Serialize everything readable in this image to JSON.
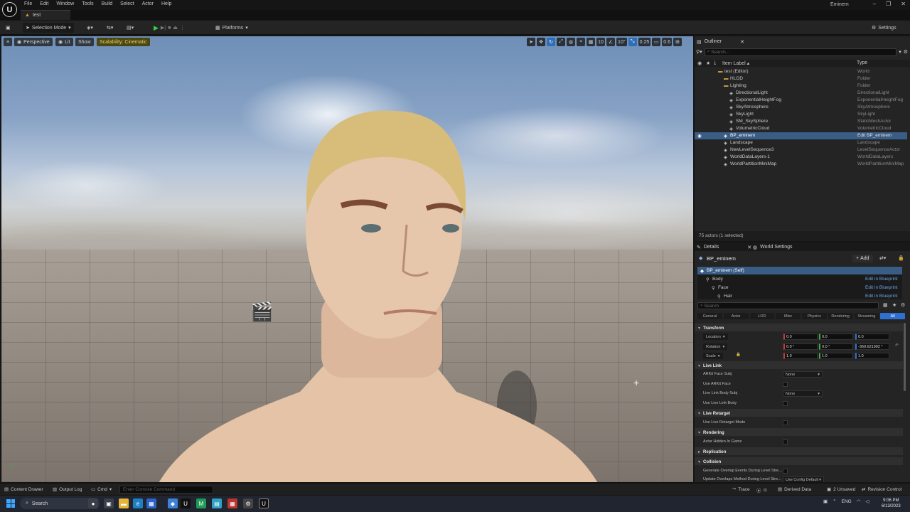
{
  "menubar": {
    "logo": "U",
    "items": [
      "File",
      "Edit",
      "Window",
      "Tools",
      "Build",
      "Select",
      "Actor",
      "Help"
    ],
    "user": "Eminem",
    "window_controls": [
      "–",
      "❐",
      "✕"
    ]
  },
  "document_tab": {
    "label": "test"
  },
  "toolbar": {
    "save_icon": "save-icon",
    "mode_label": "Selection Mode",
    "platforms_label": "Platforms",
    "settings_label": "Settings"
  },
  "viewport": {
    "perspective_label": "Perspective",
    "lit_label": "Lit",
    "show_label": "Show",
    "scalability_label": "Scalability: Cinematic",
    "grid_size": "10",
    "angle_snap": "10°",
    "scale_snap": "0.25",
    "camera_speed": "0.6"
  },
  "outliner": {
    "tab_label": "Outliner",
    "search_placeholder": "Search...",
    "col_label": "Item Label ▴",
    "col_type": "Type",
    "rows": [
      {
        "label": "test (Editor)",
        "type": "World",
        "indent": 0
      },
      {
        "label": "HLOD",
        "type": "Folder",
        "indent": 1
      },
      {
        "label": "Lighting",
        "type": "Folder",
        "indent": 1
      },
      {
        "label": "DirectionalLight",
        "type": "DirectionalLight",
        "indent": 2
      },
      {
        "label": "ExponentialHeightFog",
        "type": "ExponentialHeightFog",
        "indent": 2
      },
      {
        "label": "SkyAtmosphere",
        "type": "SkyAtmosphere",
        "indent": 2
      },
      {
        "label": "SkyLight",
        "type": "SkyLight",
        "indent": 2
      },
      {
        "label": "SM_SkySphere",
        "type": "StaticMeshActor",
        "indent": 2
      },
      {
        "label": "VolumetricCloud",
        "type": "VolumetricCloud",
        "indent": 2
      },
      {
        "label": "BP_eminem",
        "type": "Edit BP_eminem",
        "indent": 1,
        "selected": true
      },
      {
        "label": "Landscape",
        "type": "Landscape",
        "indent": 1
      },
      {
        "label": "NewLevelSequence3",
        "type": "LevelSequenceActor",
        "indent": 1
      },
      {
        "label": "WorldDataLayers-1",
        "type": "WorldDataLayers",
        "indent": 1
      },
      {
        "label": "WorldPartitionMiniMap",
        "type": "WorldPartitionMiniMap",
        "indent": 1
      }
    ],
    "status": "75 actors (1 selected)"
  },
  "details": {
    "tab_label": "Details",
    "tab2_label": "World Settings",
    "actor_name": "BP_eminem",
    "add_label": "Add",
    "components": [
      {
        "label": "BP_eminem (Self)",
        "link": "",
        "indent": 0,
        "selected": true
      },
      {
        "label": "Body",
        "link": "Edit in Blueprint",
        "indent": 1
      },
      {
        "label": "Face",
        "link": "Edit in Blueprint",
        "indent": 2
      },
      {
        "label": "Hair",
        "link": "Edit in Blueprint",
        "indent": 3
      }
    ],
    "search_placeholder": "Search",
    "categories": [
      "General",
      "Actor",
      "LOD",
      "Misc",
      "Physics",
      "Rendering",
      "Streaming",
      "All"
    ],
    "transform": {
      "title": "Transform",
      "location_label": "Location",
      "rotation_label": "Rotation",
      "scale_label": "Scale",
      "location": [
        "0.0",
        "0.0",
        "0.0"
      ],
      "rotation": [
        "0.0 °",
        "0.0 °",
        "-360.621992 °"
      ],
      "scale": [
        "1.0",
        "1.0",
        "1.0"
      ]
    },
    "live_link": {
      "title": "Live Link",
      "arkit_face_subj": "ARKit Face Subj",
      "arkit_face_subj_value": "None",
      "use_arkit_face": "Use ARKit Face",
      "body_subj": "Live Link Body Subj",
      "body_subj_value": "None",
      "use_body": "Use Live Link Body"
    },
    "live_retarget": {
      "title": "Live Retarget",
      "mode": "Use Live Retarget Mode"
    },
    "rendering": {
      "title": "Rendering",
      "hidden": "Actor Hidden In Game"
    },
    "replication": {
      "title": "Replication"
    },
    "collision": {
      "title": "Collision",
      "overlap": "Generate Overlap Events During Level Stre...",
      "update_method": "Update Overlaps Method During Level Stre...",
      "update_method_value": "Use Config Default"
    }
  },
  "statusbar": {
    "content_drawer": "Content Drawer",
    "output_log": "Output Log",
    "cmd": "Cmd",
    "console_placeholder": "Enter Console Command",
    "trace": "Trace",
    "derived_data": "Derived Data",
    "unsaved": "2 Unsaved",
    "revision_control": "Revision Control"
  },
  "taskbar": {
    "search_label": "Search",
    "lang": "ENG",
    "time": "9:06 PM",
    "date": "6/13/2023"
  }
}
